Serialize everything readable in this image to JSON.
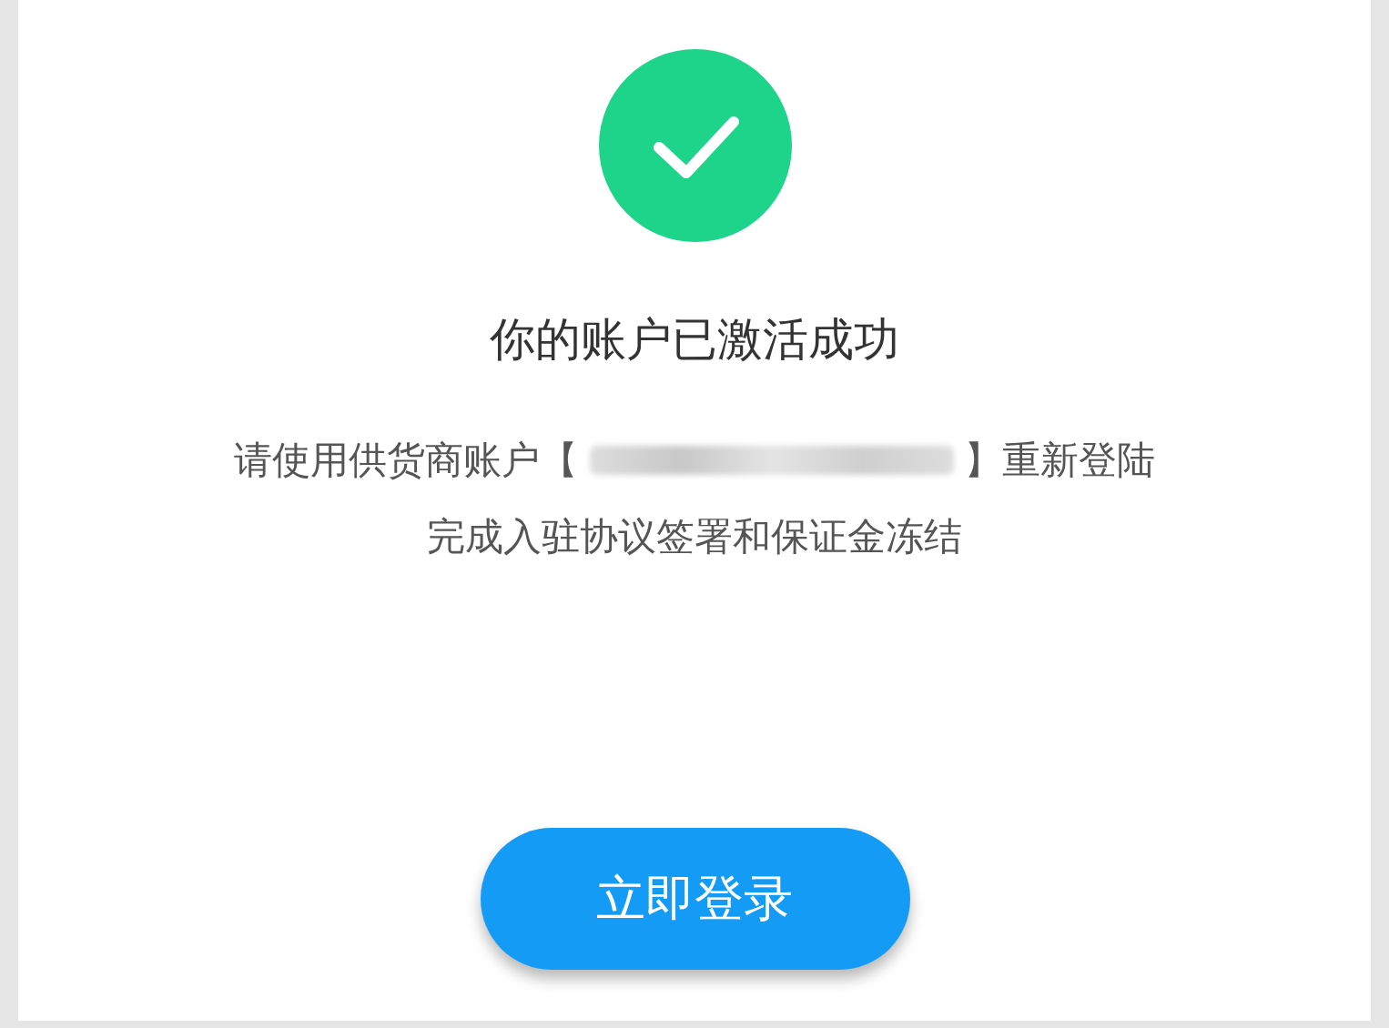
{
  "status": {
    "kind": "success"
  },
  "title": "你的账户已激活成功",
  "message": {
    "before": "请使用供货商账户【",
    "redacted": true,
    "after": "】重新登陆",
    "line2": "完成入驻协议签署和保证金冻结"
  },
  "button": {
    "label": "立即登录"
  }
}
